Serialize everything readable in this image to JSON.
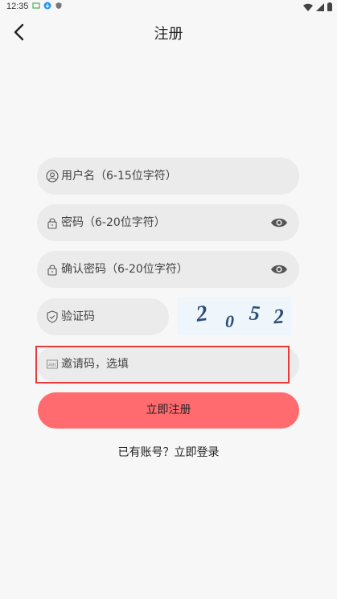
{
  "status_bar": {
    "time": "12:35"
  },
  "header": {
    "title": "注册"
  },
  "form": {
    "username_placeholder": "用户名（6-15位字符）",
    "password_placeholder": "密码（6-20位字符）",
    "confirm_password_placeholder": "确认密码（6-20位字符）",
    "captcha_placeholder": "验证码",
    "captcha_digits": [
      "2",
      "0",
      "5",
      "2"
    ],
    "invite_placeholder": "邀请码，选填",
    "submit_label": "立即注册"
  },
  "footer": {
    "login_prompt": "已有账号？立即登录"
  },
  "colors": {
    "accent": "#ff6b6e",
    "field_bg": "#ebebeb",
    "highlight": "#e53b3b"
  }
}
